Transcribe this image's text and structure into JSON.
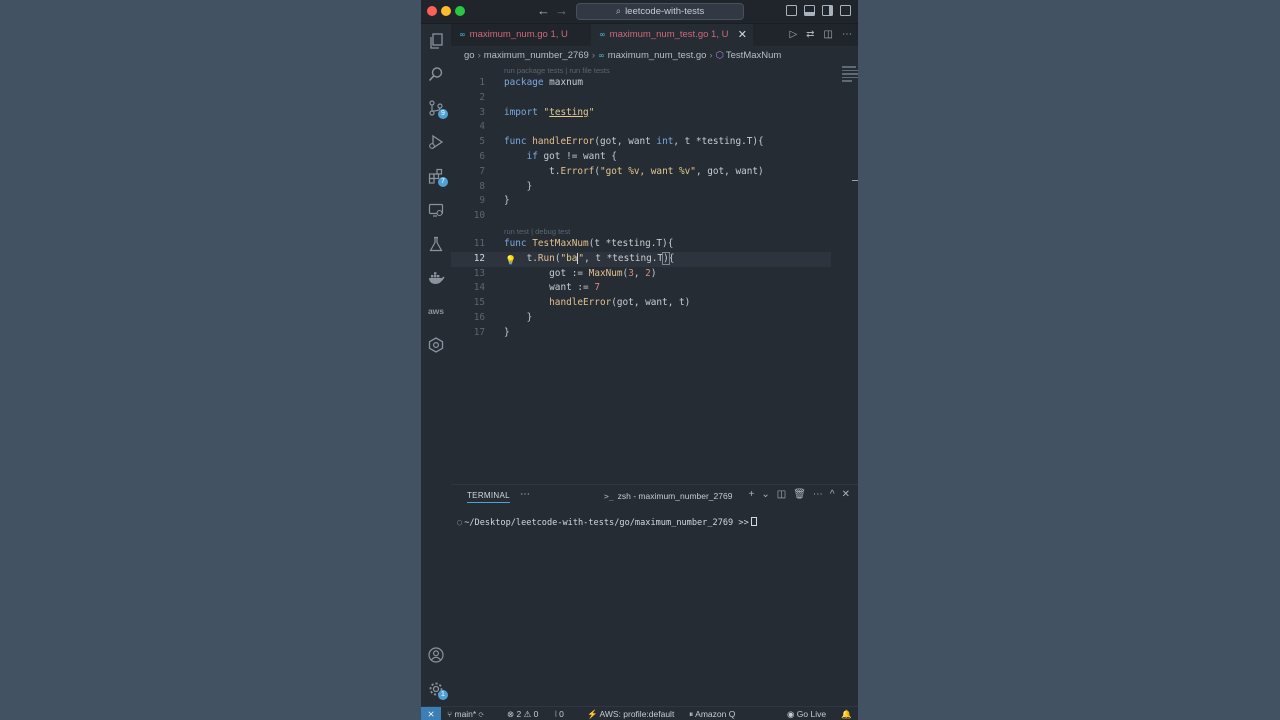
{
  "window": {
    "command_center": "leetcode-with-tests"
  },
  "activity_bar": {
    "source_control_badge": "9",
    "extensions_badge": "7",
    "aws_label": "aws",
    "manage_badge": "1"
  },
  "tabs": [
    {
      "label": "maximum_num.go 1, U",
      "active": false,
      "color": "#d06878"
    },
    {
      "label": "maximum_num_test.go 1, U",
      "active": true,
      "color": "#d06878"
    }
  ],
  "breadcrumb": {
    "items": [
      "go",
      "maximum_number_2769",
      "maximum_num_test.go",
      "TestMaxNum"
    ]
  },
  "editor": {
    "codelens_top": "run package tests | run file tests",
    "codelens_test": "run test | debug test",
    "current_line": 12,
    "lines": [
      {
        "n": "1",
        "text": "package maxnum"
      },
      {
        "n": "2",
        "text": ""
      },
      {
        "n": "3",
        "text": "import \"testing\""
      },
      {
        "n": "4",
        "text": ""
      },
      {
        "n": "5",
        "text": "func handleError(got, want int, t *testing.T){"
      },
      {
        "n": "6",
        "text": "    if got != want {"
      },
      {
        "n": "7",
        "text": "        t.Errorf(\"got %v, want %v\", got, want)"
      },
      {
        "n": "8",
        "text": "    }"
      },
      {
        "n": "9",
        "text": "}"
      },
      {
        "n": "10",
        "text": ""
      },
      {
        "n": "11",
        "text": "func TestMaxNum(t *testing.T){"
      },
      {
        "n": "12",
        "text": "    t.Run(\"ba\", t *testing.T){"
      },
      {
        "n": "13",
        "text": "        got := MaxNum(3, 2)"
      },
      {
        "n": "14",
        "text": "        want := 7"
      },
      {
        "n": "15",
        "text": "        handleError(got, want, t)"
      },
      {
        "n": "16",
        "text": "    }"
      },
      {
        "n": "17",
        "text": "}"
      }
    ]
  },
  "panel": {
    "title": "TERMINAL",
    "terminal_name": "zsh - maximum_number_2769",
    "prompt": "~/Desktop/leetcode-with-tests/go/maximum_number_2769 >>"
  },
  "statusbar": {
    "branch": "main*",
    "errors": "2",
    "warnings": "0",
    "ports": "0",
    "aws": "AWS: profile:default",
    "amazon_q": "Amazon Q",
    "go_live": "Go Live"
  }
}
